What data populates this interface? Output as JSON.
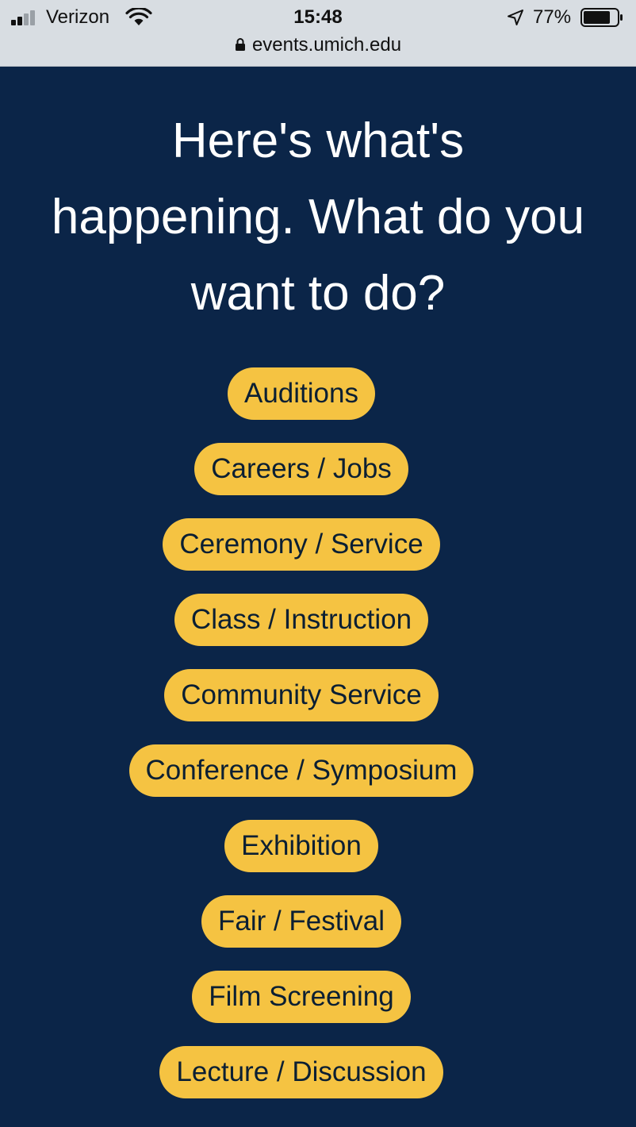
{
  "status_bar": {
    "carrier": "Verizon",
    "time": "15:48",
    "battery_percent": "77%",
    "icons": [
      "signal-bars-icon",
      "wifi-icon",
      "location-arrow-icon",
      "battery-icon",
      "lock-icon"
    ]
  },
  "browser": {
    "url": "events.umich.edu"
  },
  "page": {
    "headline": "Here's what's happening. What do you want to do?",
    "categories": [
      "Auditions",
      "Careers / Jobs",
      "Ceremony / Service",
      "Class / Instruction",
      "Community Service",
      "Conference / Symposium",
      "Exhibition",
      "Fair / Festival",
      "Film Screening",
      "Lecture / Discussion"
    ]
  },
  "colors": {
    "background": "#0b2548",
    "pill": "#f5c342",
    "pill_text": "#0b1f33",
    "headline_text": "#ffffff",
    "status_bar": "#d8dde2"
  }
}
